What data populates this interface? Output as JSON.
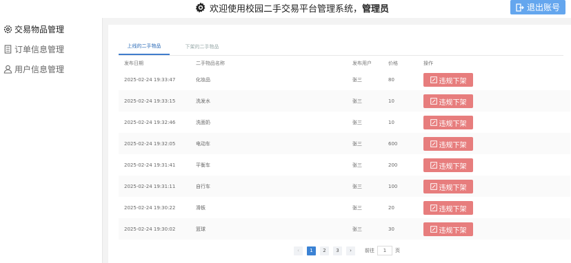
{
  "header": {
    "welcome": "欢迎使用校园二手交易平台管理系统，",
    "role": "管理员",
    "logout_label": "退出账号"
  },
  "sidebar": {
    "items": [
      {
        "label": "交易物品管理",
        "icon": "gear-icon"
      },
      {
        "label": "订单信息管理",
        "icon": "document-icon"
      },
      {
        "label": "用户信息管理",
        "icon": "user-icon"
      }
    ]
  },
  "tabs": [
    {
      "label": "上线的二手物品"
    },
    {
      "label": "下架的二手物品"
    }
  ],
  "table": {
    "headers": [
      "发布日期",
      "二手物品名称",
      "发布用户",
      "价格",
      "操作"
    ],
    "rows": [
      {
        "date": "2025-02-24 19:33:47",
        "name": "化妆品",
        "user": "张三",
        "price": "80"
      },
      {
        "date": "2025-02-24 19:33:15",
        "name": "洗发水",
        "user": "张三",
        "price": "10"
      },
      {
        "date": "2025-02-24 19:32:46",
        "name": "洗面奶",
        "user": "张三",
        "price": "10"
      },
      {
        "date": "2025-02-24 19:32:05",
        "name": "电动车",
        "user": "张三",
        "price": "600"
      },
      {
        "date": "2025-02-24 19:31:41",
        "name": "平衡车",
        "user": "张三",
        "price": "200"
      },
      {
        "date": "2025-02-24 19:31:11",
        "name": "自行车",
        "user": "张三",
        "price": "100"
      },
      {
        "date": "2025-02-24 19:30:22",
        "name": "滑板",
        "user": "张三",
        "price": "20"
      },
      {
        "date": "2025-02-24 19:30:02",
        "name": "篮球",
        "user": "张三",
        "price": "30"
      }
    ],
    "action_label": "违规下架"
  },
  "pagination": {
    "prev": "‹",
    "pages": [
      "1",
      "2",
      "3"
    ],
    "current": "1",
    "next": "›",
    "goto_prefix": "前往",
    "goto_value": "1",
    "goto_suffix": "页"
  }
}
